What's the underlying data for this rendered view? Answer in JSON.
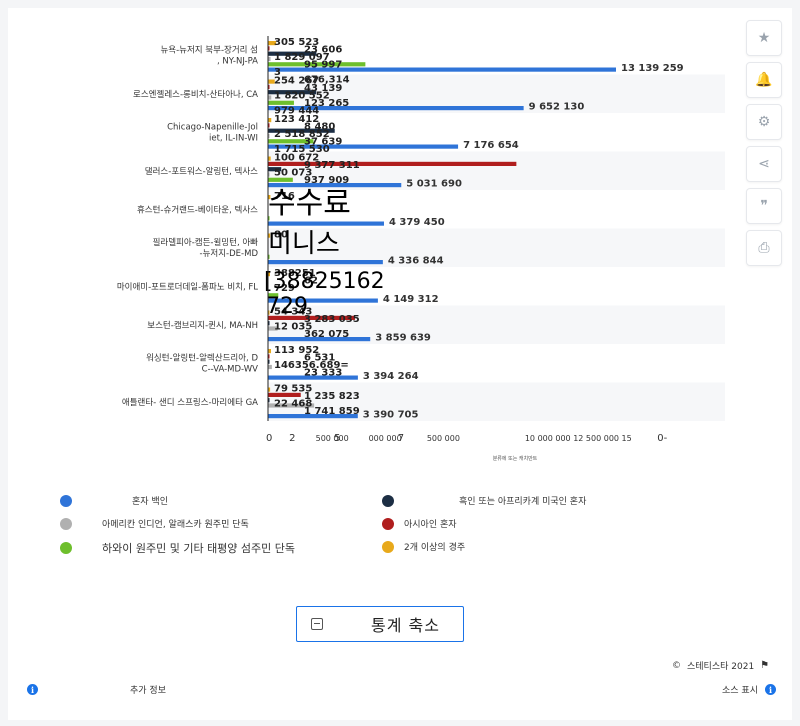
{
  "chart_data": {
    "type": "bar",
    "orientation": "horizontal",
    "categories": [
      "뉴욕-뉴저지 북부-장거리 섬, NY-NJ-PA",
      "로스엔젤레스-롱비치-산타아나, CA",
      "Chicago-Napenille-Joliet, IL-IN-WI",
      "댈러스-포트워스-알링턴, 텍사스",
      "휴스턴-슈거랜드-베이타운, 텍사스",
      "필라델피아-캠든-윌밍턴, 아빠-뉴저지-DE-MD",
      "마이애미-포트로더데일-폼파노 비치, FL",
      "보스턴-캠브리지-퀸시, MA-NH",
      "워싱턴-알링턴-알렉산드리아, DC--VA-MD-WV",
      "애틀랜타- 샌디 스프링스-마리에타 GA"
    ],
    "series": [
      {
        "name": "2개 이상의 경주",
        "color": "#e8a91b",
        "values": [
          305523,
          254267,
          123412,
          100672,
          90000,
          80000,
          75000,
          54343,
          113952,
          79535
        ]
      },
      {
        "name": "아시아인 혼자",
        "color": "#b01e1e",
        "values": [
          23606,
          43139,
          8480,
          9377311,
          0,
          0,
          0,
          3283035,
          6531,
          1235823
        ]
      },
      {
        "name": "흑인 또는 아프리카계 미국인 혼자",
        "color": "#1c2e44",
        "values": [
          1829097,
          1820552,
          2518852,
          500000,
          0,
          0,
          0,
          12035,
          23333,
          22468
        ]
      },
      {
        "name": "아메리칸 인디언, 알래스카 원주민 단독",
        "color": "#b0b0b0",
        "values": [
          95997,
          123265,
          37639,
          50073,
          0,
          0,
          0,
          362075,
          146356.689,
          1741859
        ]
      },
      {
        "name": "하와이 원주민 및 기타 태평양 섬주민 단독",
        "color": "#6ebf2c",
        "values": [
          3676314,
          979444,
          1715530,
          937909,
          716,
          80,
          388251,
          0,
          0,
          0
        ]
      },
      {
        "name": "혼자 백인",
        "color": "#2f74d8",
        "values": [
          13139259,
          9652130,
          7176654,
          5031690,
          4379450,
          4336844,
          4149312,
          3859639,
          3394264,
          3390705
        ]
      }
    ],
    "bar_labels": [
      [
        "305 523",
        "23 606",
        "1 829 097",
        "95 997",
        "3",
        "676,314",
        "13 139 259"
      ],
      [
        "254 267",
        "43 139",
        "1 820 552",
        "123 265",
        "979 444",
        "9 652 130"
      ],
      [
        "123 412",
        "8 480",
        "2 518 852",
        "37 639",
        "1 715 530",
        "7 176 654"
      ],
      [
        "100 672",
        "9 377 311",
        "50 073",
        "937 909",
        "5 031 690"
      ],
      [
        "716",
        "4 379 450"
      ],
      [
        "80",
        "4 336 844"
      ],
      [
        "388251",
        "62",
        "729",
        "4 149 312"
      ],
      [
        "54 343",
        "3 283 035",
        "12 035",
        "362 075",
        "3 859 639"
      ],
      [
        "113 952",
        "6 531",
        "146356.689=",
        "23 333",
        "3 394 264"
      ],
      [
        "79 535",
        "1 235 823",
        "22 468",
        "1 741 859",
        "3 390 705"
      ]
    ],
    "overlay_text": [
      "수수료",
      "미니스",
      "[38825162",
      "729"
    ],
    "x_ticks": [
      "0",
      "2",
      "500 000",
      "5",
      "000 000",
      "7",
      "500 000",
      "10 000 000 12 500 000 15",
      "0-"
    ],
    "x_tick_values": [
      0,
      1100000,
      2100000,
      2800000,
      4100000,
      5200000,
      6300000,
      10000000,
      15000000
    ],
    "xlabel": "분류에 또는 캐치만트",
    "xlim": [
      0,
      16500000
    ],
    "grid": false,
    "legend_position": "bottom"
  },
  "legend": [
    {
      "label": "혼자 백인",
      "color": "#2f74d8"
    },
    {
      "label": "흑인 또는 아프리카계 미국인 혼자",
      "color": "#1c2e44"
    },
    {
      "label": "아메리칸 인디언, 알래스카 원주민 단독",
      "color": "#b0b0b0"
    },
    {
      "label": "아시아인 혼자",
      "color": "#b01e1e"
    },
    {
      "label": "하와이 원주민 및 기타 태평양 섬주민 단독",
      "color": "#6ebf2c"
    },
    {
      "label": "2개 이상의 경주",
      "color": "#e8a91b"
    }
  ],
  "sidebar": [
    {
      "name": "star-icon",
      "glyph": "★"
    },
    {
      "name": "bell-icon",
      "glyph": "🔔"
    },
    {
      "name": "gear-icon",
      "glyph": "⚙"
    },
    {
      "name": "share-icon",
      "glyph": "⋖"
    },
    {
      "name": "quote-icon",
      "glyph": "❞"
    },
    {
      "name": "print-icon",
      "glyph": "⎙"
    }
  ],
  "collapse_label": "통계 축소",
  "copyright": "스테티스타 2021",
  "more_info": "추가 정보",
  "show_source": "소스 표시"
}
